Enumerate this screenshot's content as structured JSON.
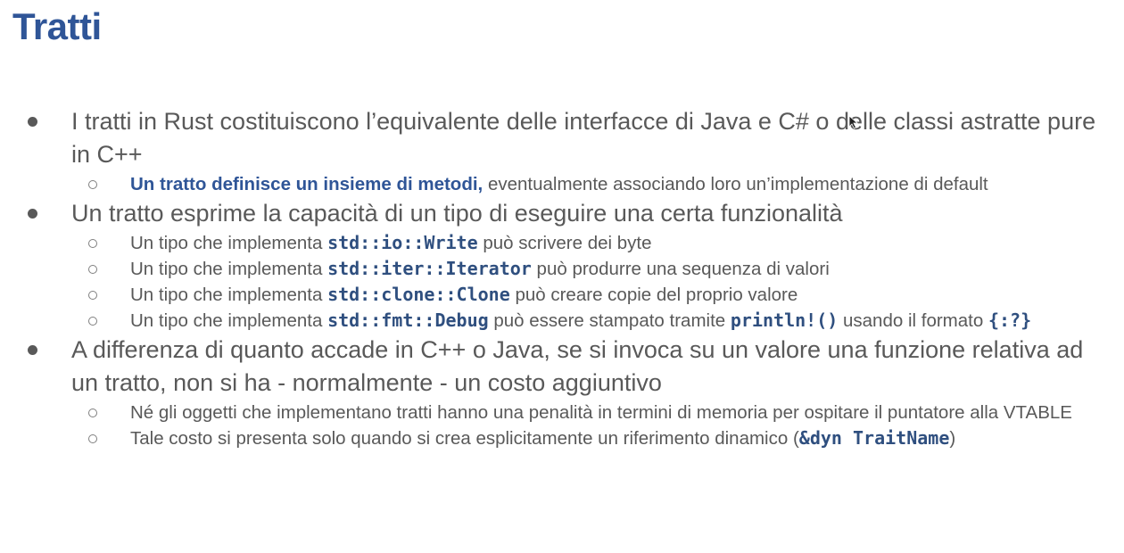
{
  "title": "Tratti",
  "bullets": [
    {
      "text": "I tratti in Rust costituiscono l’equivalente delle interfacce di Java e C# o delle classi astratte pure in C++",
      "sub": [
        {
          "emph": "Un tratto definisce un insieme di metodi,",
          "rest": " eventualmente associando loro un’implementazione di default"
        }
      ]
    },
    {
      "text": "Un tratto esprime la capacità di un tipo di eseguire una certa funzionalità",
      "sub": [
        {
          "pre": "Un tipo che implementa ",
          "code": "std::io::Write",
          "post": " può scrivere dei byte"
        },
        {
          "pre": "Un tipo che implementa ",
          "code": "std::iter::Iterator",
          "post": " può produrre una sequenza di valori"
        },
        {
          "pre": "Un tipo che implementa ",
          "code": "std::clone::Clone",
          "post": " può creare copie del proprio valore"
        },
        {
          "pre": "Un tipo che implementa ",
          "code": "std::fmt::Debug",
          "mid": " può essere stampato tramite ",
          "code2": "println!()",
          "mid2": " usando il formato ",
          "code3": "{:?}"
        }
      ]
    },
    {
      "text": "A differenza di quanto accade in C++ o Java, se si invoca su un valore una funzione relativa ad un tratto, non si ha - normalmente - un costo aggiuntivo",
      "sub": [
        {
          "text": "Né gli oggetti che implementano tratti hanno una penalità in termini di memoria per ospitare il puntatore alla VTABLE"
        },
        {
          "pre": "Tale costo si presenta solo quando si crea esplicitamente un riferimento dinamico (",
          "code": "&dyn TraitName",
          "post": ")"
        }
      ]
    }
  ]
}
